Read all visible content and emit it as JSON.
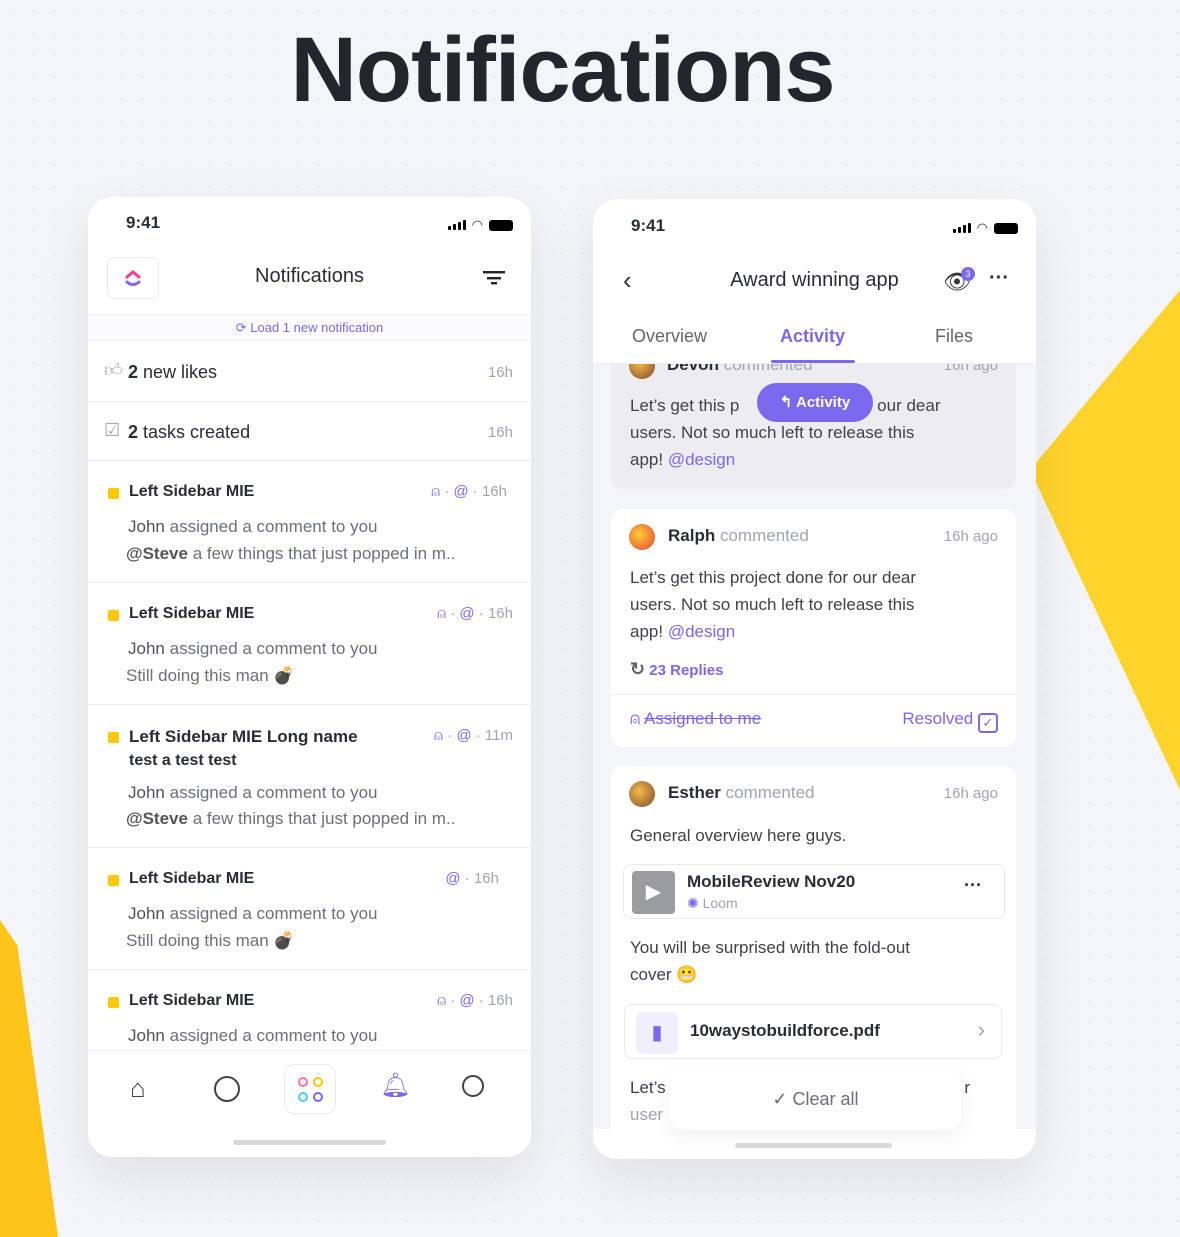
{
  "page_title": "Notifications",
  "colors": {
    "accent": "#7b68ee",
    "yellow": "#ffc800",
    "text": "#292d34"
  },
  "left": {
    "status_time": "9:41",
    "header_title": "Notifications",
    "load_new": "Load 1 new notification",
    "summary": [
      {
        "icon": "thumbs-up-icon",
        "count": "2",
        "label": "new likes",
        "time": "16h"
      },
      {
        "icon": "checkbox-icon",
        "count": "2",
        "label": "tasks created",
        "time": "16h"
      }
    ],
    "items": [
      {
        "title": "Left Sidebar MIE",
        "time": "16h",
        "actor": "John",
        "action": "assigned a comment to you",
        "mention": "@Steve",
        "preview": "a few things that just popped in m..",
        "line2": ""
      },
      {
        "title": "Left Sidebar MIE",
        "time": "16h",
        "actor": "John",
        "action": "assigned a comment to you",
        "mention": "",
        "preview": "Still doing this man 💣",
        "line2": ""
      },
      {
        "title": "Left Sidebar MIE Long name",
        "title2": "test a test test",
        "time": "11m",
        "actor": "John",
        "action": "assigned a comment to you",
        "mention": "@Steve",
        "preview": "a few things that just popped in m.."
      },
      {
        "title": "Left Sidebar MIE",
        "time": "16h",
        "actor": "John",
        "action": "assigned a comment to you",
        "mention": "",
        "preview": "Still doing this man 💣"
      },
      {
        "title": "Left Sidebar MIE",
        "time": "16h",
        "actor": "John",
        "action": "assigned a comment to you"
      }
    ],
    "nav": [
      "home-icon",
      "compass-icon",
      "apps-icon",
      "bell-icon",
      "search-icon"
    ]
  },
  "right": {
    "status_time": "9:41",
    "header_title": "Award winning app",
    "watchers_badge": "3",
    "tabs": [
      "Overview",
      "Activity",
      "Files"
    ],
    "active_tab": "Activity",
    "activity_pill": "Activity",
    "devon": {
      "name": "Devon",
      "verb": "commented",
      "time": "16h ago",
      "text_a": "Let’s get this p",
      "text_b": "or our dear",
      "text_c": "users. Not so much left to release this",
      "text_d": "app!",
      "mention": "@design"
    },
    "ralph": {
      "name": "Ralph",
      "verb": "commented",
      "time": "16h ago",
      "text1": "Let’s get this project done for our dear",
      "text2": "users. Not so much left to release this",
      "text3": "app!",
      "mention": "@design",
      "replies": "23 Replies",
      "assigned": "Assigned to me",
      "resolved": "Resolved"
    },
    "esther": {
      "name": "Esther",
      "verb": "commented",
      "time": "16h ago",
      "text": "General overview here guys.",
      "video_title": "MobileReview Nov20",
      "video_source": "Loom",
      "text2": "You will be surprised with the fold-out",
      "text3": "cover 😬",
      "file": "10waystobuildforce.pdf",
      "text4a": "Let’s",
      "text4b": "r",
      "text5": "user"
    },
    "clear_all": "Clear all"
  }
}
